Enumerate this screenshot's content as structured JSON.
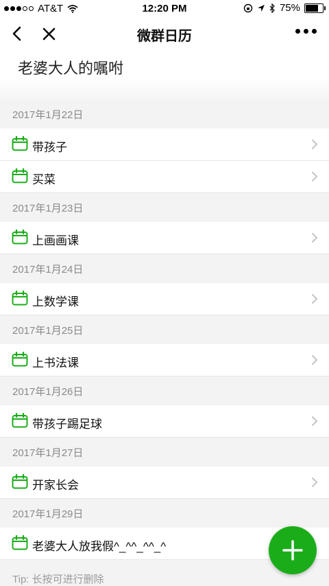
{
  "status": {
    "carrier": "AT&T",
    "time": "12:20 PM",
    "battery": "75%",
    "battery_level": 0.75
  },
  "nav": {
    "title": "微群日历"
  },
  "page": {
    "subtitle": "老婆大人的嘱咐"
  },
  "groups": [
    {
      "date": "2017年1月22日",
      "items": [
        "带孩子",
        "买菜"
      ]
    },
    {
      "date": "2017年1月23日",
      "items": [
        "上画画课"
      ]
    },
    {
      "date": "2017年1月24日",
      "items": [
        "上数学课"
      ]
    },
    {
      "date": "2017年1月25日",
      "items": [
        "上书法课"
      ]
    },
    {
      "date": "2017年1月26日",
      "items": [
        "带孩子踢足球"
      ]
    },
    {
      "date": "2017年1月27日",
      "items": [
        "开家长会"
      ]
    },
    {
      "date": "2017年1月29日",
      "items": [
        "老婆大人放我假^_^^_^^_^"
      ]
    }
  ],
  "tip": "Tip: 长按可进行删除",
  "colors": {
    "accent": "#1aad19"
  }
}
